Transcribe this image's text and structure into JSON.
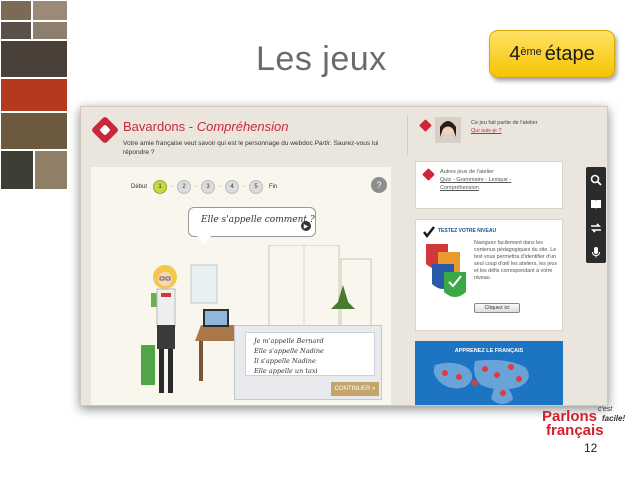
{
  "slide": {
    "title": "Les jeux",
    "step_badge": {
      "ordinal": "4",
      "superscript": "ème",
      "word": "étape"
    },
    "page_number": "12"
  },
  "app": {
    "title_prefix": "Bavardons - ",
    "title_italic": "Compréhension",
    "description_1": "Votre amie française veut savoir qui est le personnage du webdoc ",
    "description_italic": "Partir",
    "description_2": ". Saurez-vous lui répondre ?",
    "progress": {
      "start": "Début",
      "steps": [
        "1",
        "2",
        "3",
        "4",
        "5"
      ],
      "end": "Fin",
      "active_index": 0
    },
    "help": "?",
    "question": "Elle s'appelle comment ?",
    "answers": [
      "Je m'appelle Bernard",
      "Elle s'appelle Nadine",
      "Il s'appelle Nadine",
      "Elle appelle un taxi"
    ],
    "continue_label": "CONTINUER »"
  },
  "sidebar": {
    "workshop_promo": {
      "line1": "Ce jeu fait partie de l'atelier",
      "link": "Qui suis-je ?"
    },
    "other_games": {
      "title": "Autres jeux de l'atelier",
      "link": "Quiz - Grammaire - Lexique - Compréhension"
    },
    "test_level": {
      "heading": "TESTEZ VOTRE NIVEAU",
      "text": "Naviguez facilement dans les contenus pédagogiques du site. Le test vous permettra d'identifier d'un seul coup d'œil les ateliers, les jeux et les défis correspondant à votre niveau.",
      "button": "Cliquez ici"
    },
    "map_title": "APPRENEZ LE FRANÇAIS"
  },
  "toolbar_icons": [
    "search-icon",
    "book-icon",
    "swap-icon",
    "microphone-icon"
  ],
  "logo": {
    "line1": "Parlons",
    "line2": "français",
    "cest": "c'est",
    "facile": "facile!"
  },
  "colors": {
    "accent_red": "#c9283a",
    "badge_yellow": "#f5c400",
    "map_blue": "#1d74c2"
  }
}
